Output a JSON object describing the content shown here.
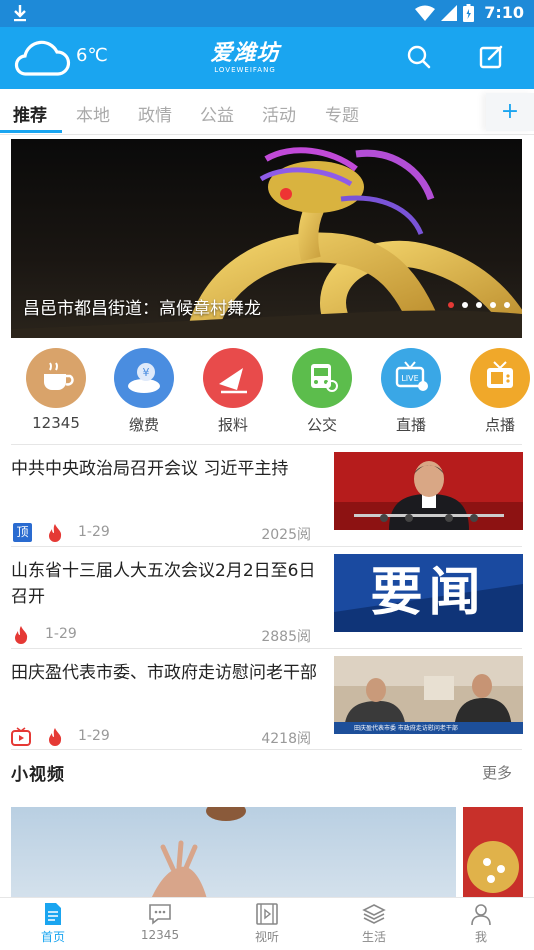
{
  "status_bar": {
    "time": "7:10"
  },
  "header": {
    "temperature": "6℃",
    "logo_text": "爱潍坊",
    "logo_sub": "LOVEWEIFANG"
  },
  "tabs": [
    {
      "label": "推荐",
      "active": true
    },
    {
      "label": "本地"
    },
    {
      "label": "政情"
    },
    {
      "label": "公益"
    },
    {
      "label": "活动"
    },
    {
      "label": "专题"
    }
  ],
  "tab_add": "+",
  "banner": {
    "caption": "昌邑市都昌街道：高候章村舞龙",
    "slide_count": 5,
    "active_slide": 1
  },
  "quick_links": [
    {
      "label": "12345",
      "icon": "coffee-cup-icon",
      "color": "#d9a36a"
    },
    {
      "label": "缴费",
      "icon": "yuan-payment-icon",
      "color": "#4a8de0"
    },
    {
      "label": "报料",
      "icon": "paper-plane-icon",
      "color": "#e84b4b"
    },
    {
      "label": "公交",
      "icon": "bus-icon",
      "color": "#5cbd4c"
    },
    {
      "label": "直播",
      "icon": "live-tv-icon",
      "color": "#3aa7e6"
    },
    {
      "label": "点播",
      "icon": "tv-icon",
      "color": "#f0a82a"
    }
  ],
  "news": [
    {
      "title": "中共中央政治局召开会议 习近平主持",
      "badge": "顶",
      "date": "1-29",
      "reads": "2025阅"
    },
    {
      "title": "山东省十三届人大五次会议2月2日至6日召开",
      "date": "1-29",
      "reads": "2885阅",
      "thumb_text": "要闻"
    },
    {
      "title": "田庆盈代表市委、市政府走访慰问老干部",
      "date": "1-29",
      "reads": "4218阅",
      "thumb_caption": "田庆盈代表市委 市政府走访慰问老干部"
    }
  ],
  "small_video": {
    "title": "小视频",
    "more": "更多"
  },
  "bottom_nav": [
    {
      "label": "首页",
      "icon": "home-document-icon",
      "active": true
    },
    {
      "label": "12345",
      "icon": "chat-bubble-icon"
    },
    {
      "label": "视听",
      "icon": "film-play-icon"
    },
    {
      "label": "生活",
      "icon": "layers-icon"
    },
    {
      "label": "我",
      "icon": "person-icon"
    }
  ],
  "colors": {
    "brand": "#1aa5f0",
    "status_bar": "#1e8ad8",
    "hot": "#e53935"
  }
}
